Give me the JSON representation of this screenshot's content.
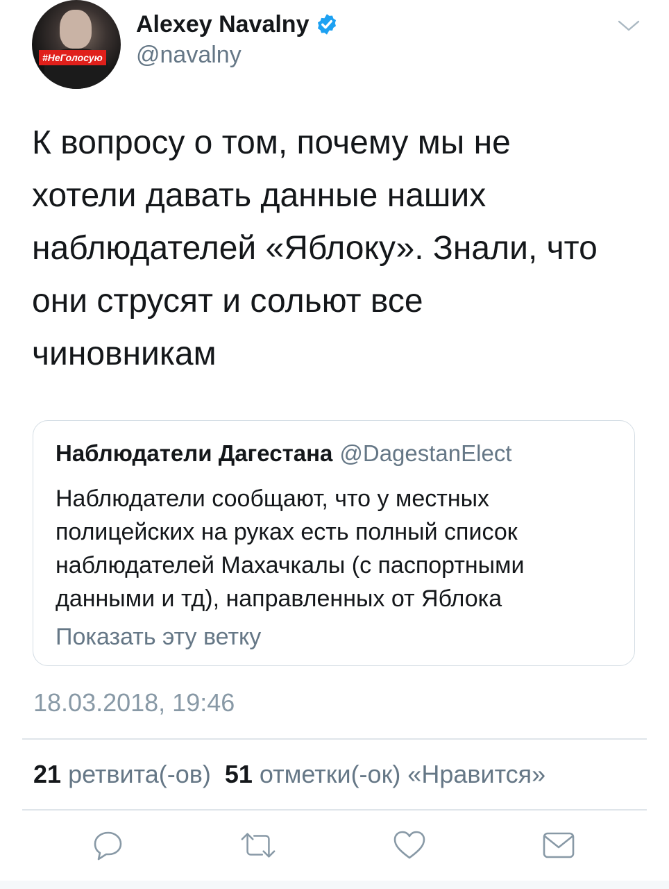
{
  "colors": {
    "primary_text": "#14171a",
    "secondary_text": "#657786",
    "verified_blue": "#1da1f2",
    "icon_gray": "#8899a6"
  },
  "author": {
    "name": "Alexey Navalny",
    "handle": "@navalny",
    "verified": true,
    "avatar_tag": "#НеГолосую"
  },
  "tweet": {
    "lines": [
      "К вопросу о том, почему мы не",
      "хотели давать данные наших",
      "наблюдателей «Яблоку». Знали, что",
      "они струсят и сольют все",
      "чиновникам"
    ]
  },
  "quoted_tweet": {
    "name": "Наблюдатели Дагестана",
    "handle": "@DagestanElect",
    "lines": [
      "Наблюдатели сообщают, что у местных",
      "полицейских на руках есть полный список",
      "наблюдателей Махачкалы (с паспортными",
      "данными и тд), направленных от Яблока"
    ],
    "show_thread": "Показать эту ветку"
  },
  "timestamp": "18.03.2018, 19:46",
  "stats": {
    "retweets_count": "21",
    "retweets_label": "ретвита(-ов)",
    "likes_count": "51",
    "likes_label": "отметки(-ок) «Нравится»"
  },
  "actions": {
    "reply_icon": "reply-icon",
    "retweet_icon": "retweet-icon",
    "like_icon": "heart-icon",
    "message_icon": "envelope-icon"
  }
}
